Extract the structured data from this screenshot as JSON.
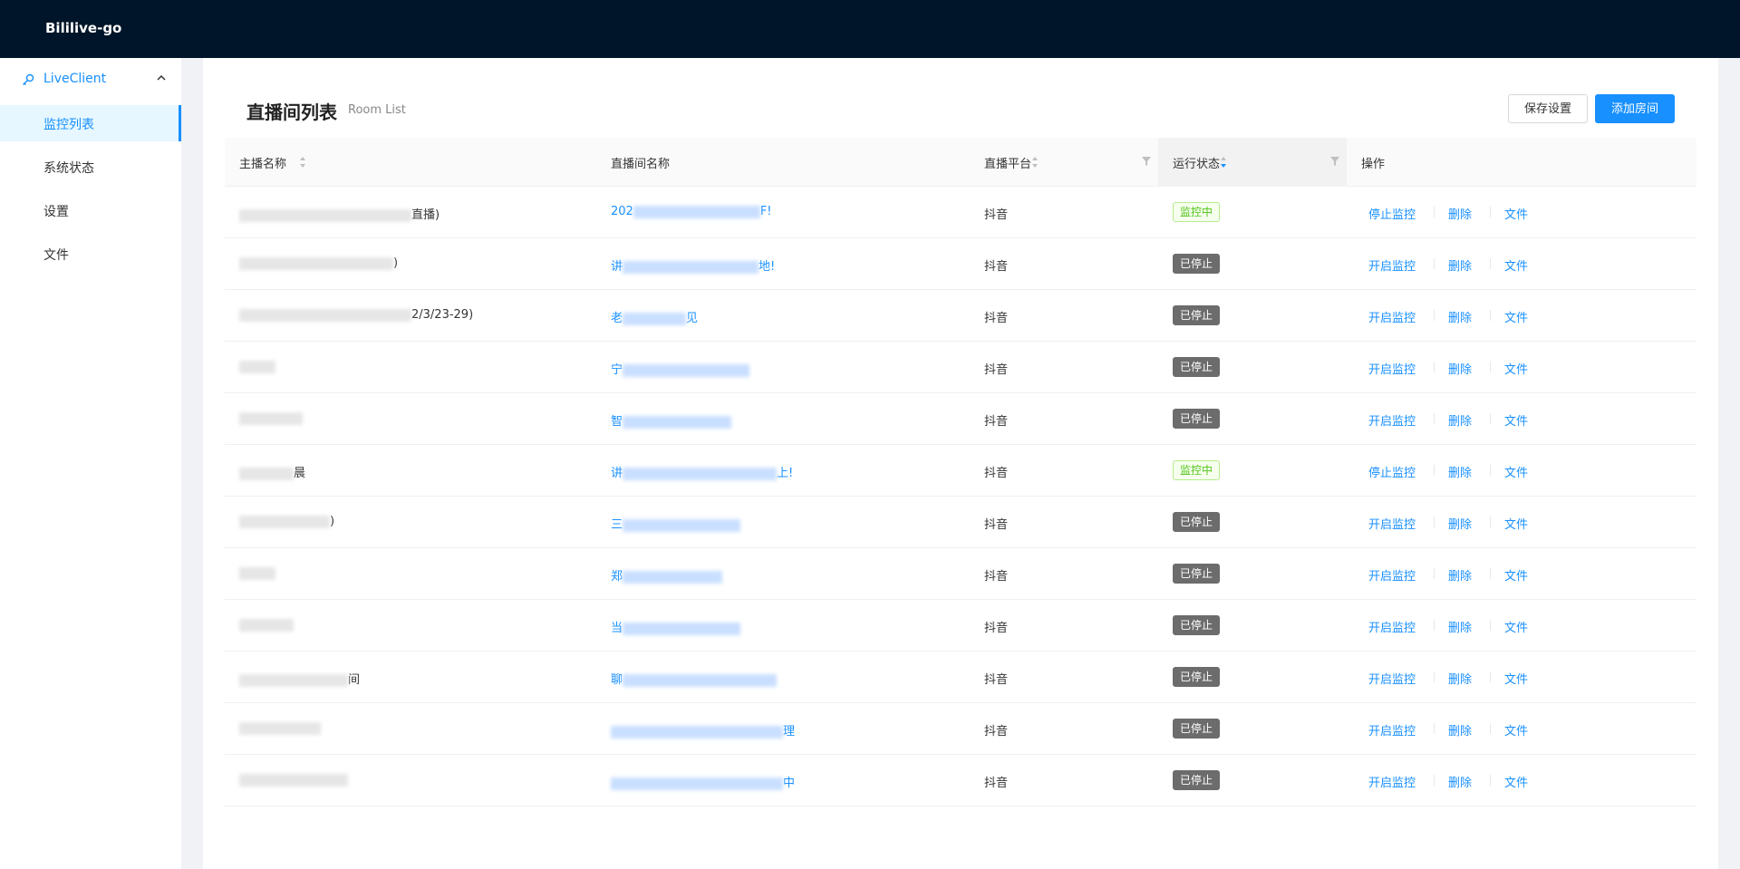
{
  "app": {
    "title": "Bililive-go"
  },
  "sidebar": {
    "group_label": "LiveClient",
    "items": [
      {
        "label": "监控列表",
        "active": true
      },
      {
        "label": "系统状态",
        "active": false
      },
      {
        "label": "设置",
        "active": false
      },
      {
        "label": "文件",
        "active": false
      }
    ]
  },
  "page": {
    "title": "直播间列表",
    "subtitle": "Room List",
    "save_label": "保存设置",
    "add_label": "添加房间"
  },
  "table": {
    "columns": [
      "主播名称",
      "直播间名称",
      "直播平台",
      "运行状态",
      "操作"
    ],
    "rows": [
      {
        "host_tail": "直播)",
        "room_head": "202",
        "room_tail": "F!",
        "platform": "抖音",
        "status": "监控中",
        "monitoring": true,
        "op1": "停止监控"
      },
      {
        "host_tail": ")",
        "room_head": "讲",
        "room_tail": "地!",
        "platform": "抖音",
        "status": "已停止",
        "monitoring": false,
        "op1": "开启监控"
      },
      {
        "host_tail": "2/3/23-29)",
        "room_head": "老",
        "room_tail": "见",
        "platform": "抖音",
        "status": "已停止",
        "monitoring": false,
        "op1": "开启监控"
      },
      {
        "host_tail": "",
        "room_head": "宁",
        "room_tail": "",
        "platform": "抖音",
        "status": "已停止",
        "monitoring": false,
        "op1": "开启监控"
      },
      {
        "host_tail": "",
        "room_head": "智",
        "room_tail": "",
        "platform": "抖音",
        "status": "已停止",
        "monitoring": false,
        "op1": "开启监控"
      },
      {
        "host_tail": "晨",
        "room_head": "讲",
        "room_tail": "上!",
        "platform": "抖音",
        "status": "监控中",
        "monitoring": true,
        "op1": "停止监控"
      },
      {
        "host_tail": ")",
        "room_head": "三",
        "room_tail": "",
        "platform": "抖音",
        "status": "已停止",
        "monitoring": false,
        "op1": "开启监控"
      },
      {
        "host_tail": "",
        "room_head": "郑",
        "room_tail": "",
        "platform": "抖音",
        "status": "已停止",
        "monitoring": false,
        "op1": "开启监控"
      },
      {
        "host_tail": "",
        "room_head": "当",
        "room_tail": "",
        "platform": "抖音",
        "status": "已停止",
        "monitoring": false,
        "op1": "开启监控"
      },
      {
        "host_tail": "间",
        "room_head": "聊",
        "room_tail": "",
        "platform": "抖音",
        "status": "已停止",
        "monitoring": false,
        "op1": "开启监控"
      },
      {
        "host_tail": "",
        "room_head": "",
        "room_tail": "理",
        "platform": "抖音",
        "status": "已停止",
        "monitoring": false,
        "op1": "开启监控"
      },
      {
        "host_tail": "",
        "room_head": "",
        "room_tail": "中",
        "platform": "抖音",
        "status": "已停止",
        "monitoring": false,
        "op1": "开启监控"
      }
    ],
    "op_delete": "删除",
    "op_file": "文件"
  },
  "colors": {
    "accent": "#1890ff",
    "header_bg": "#001529",
    "monitoring": "#52c41a",
    "stopped": "#6c6c6c"
  }
}
